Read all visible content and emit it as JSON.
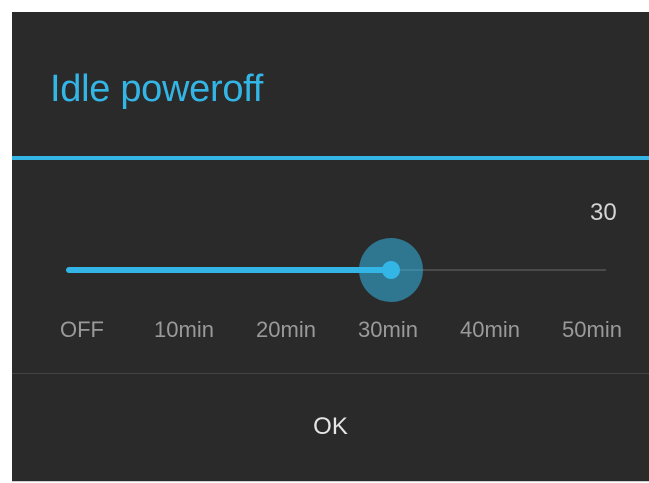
{
  "dialog": {
    "title": "Idle poweroff",
    "current_value": "30",
    "slider": {
      "selected_index": 3,
      "options": [
        "OFF",
        "10min",
        "20min",
        "30min",
        "40min",
        "50min"
      ]
    },
    "ok_label": "OK"
  },
  "colors": {
    "accent": "#33b5e5",
    "background": "#2a2a2a",
    "muted_text": "#9a9a9a"
  }
}
